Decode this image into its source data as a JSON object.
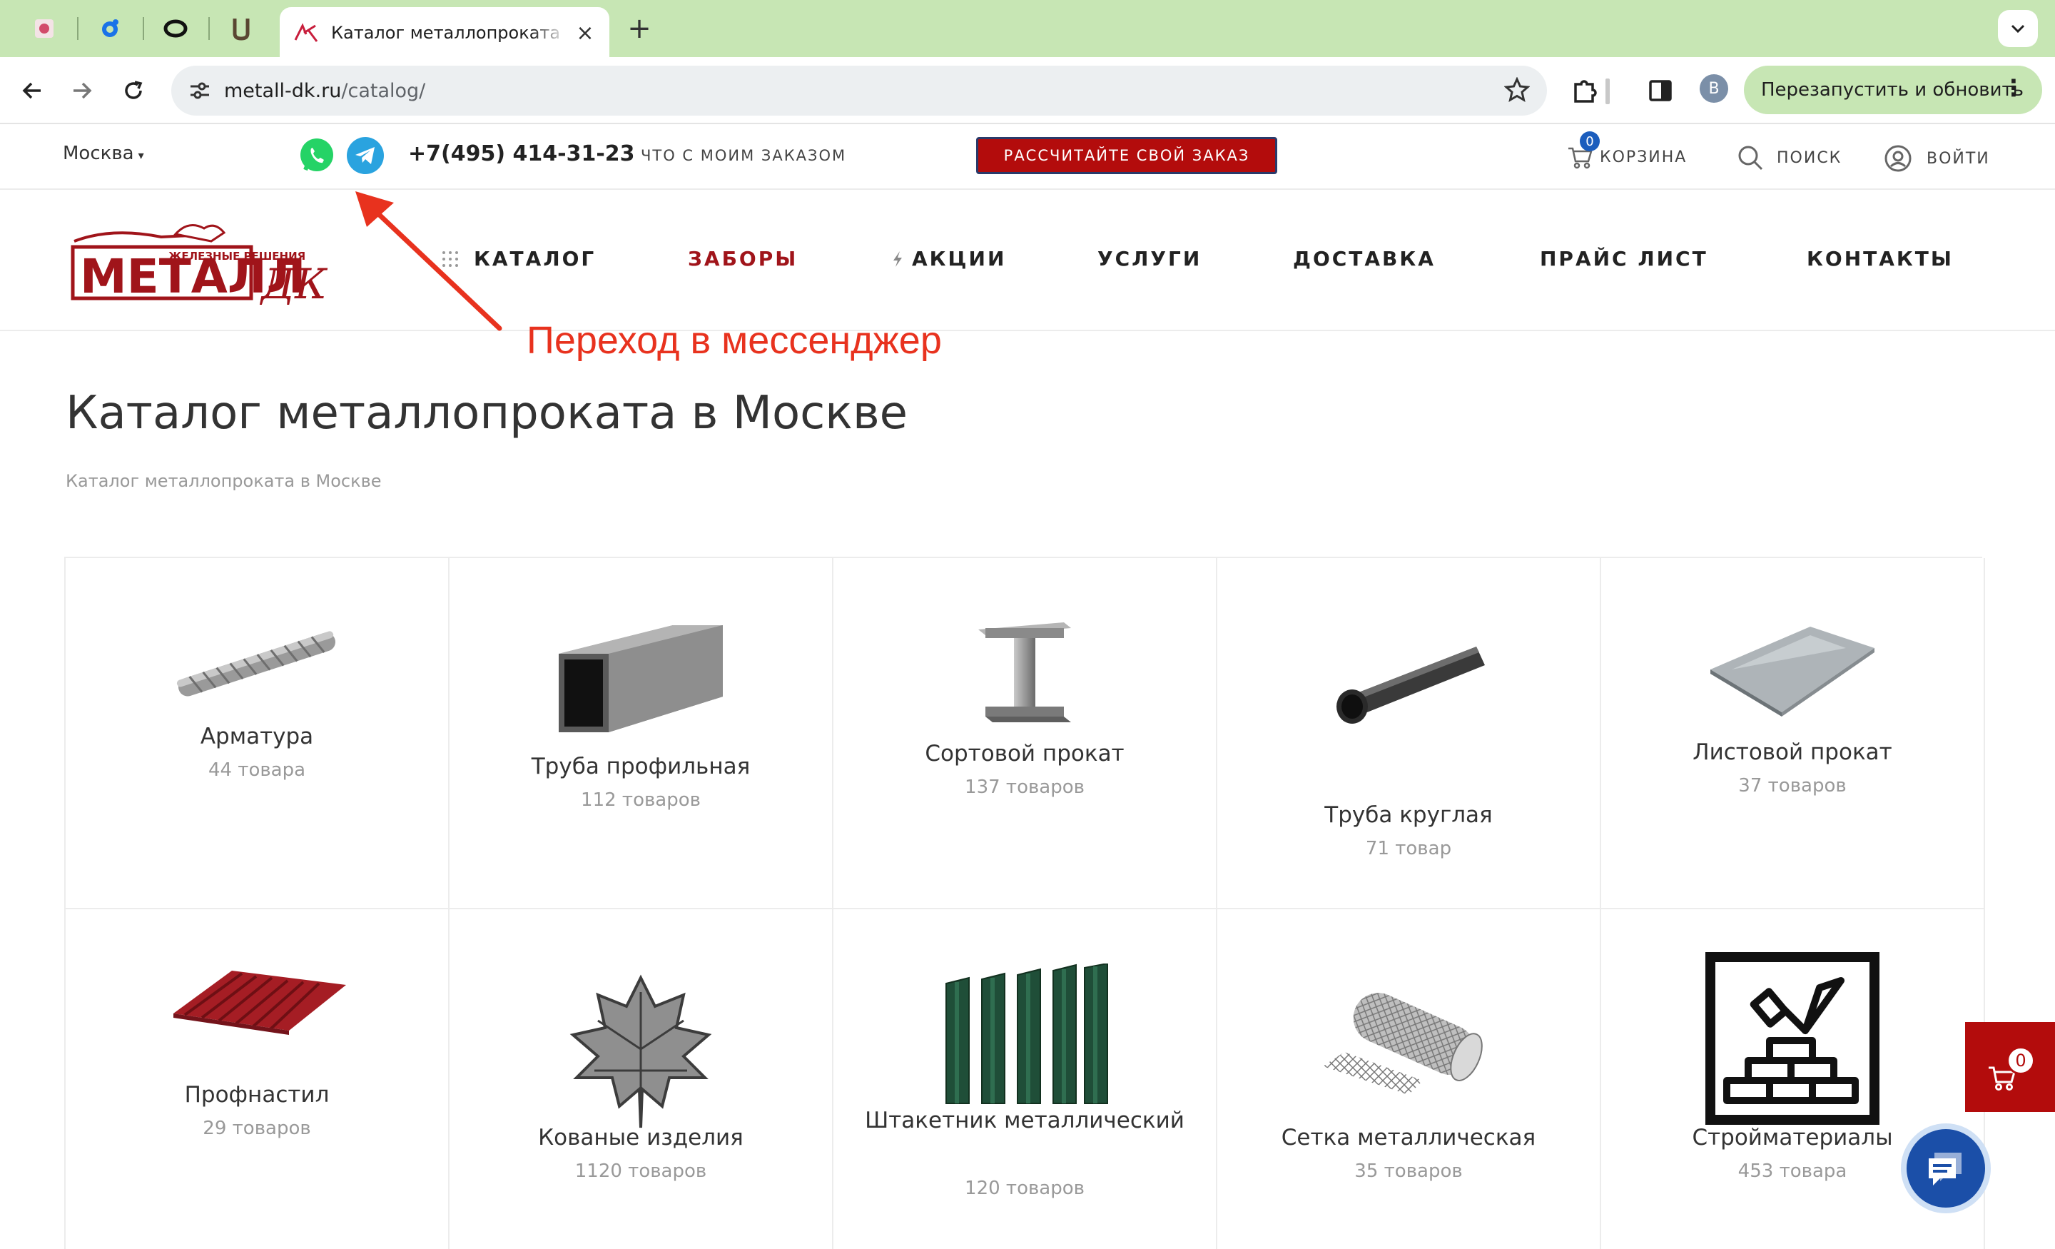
{
  "browser": {
    "pinned_tabs": [
      "favicon-1",
      "favicon-2",
      "favicon-3",
      "favicon-4"
    ],
    "active_tab_title": "Каталог металлопроката в М",
    "url_host": "metall-dk.ru",
    "url_path": "/catalog/",
    "profile_initial": "В",
    "relaunch_label": "Перезапустить и обновить"
  },
  "topbar": {
    "city": "Москва",
    "phone": "+7(495) 414-31-23",
    "order_status_link": "что с моим заказом",
    "calc_button": "Рассчитайте свой заказ",
    "cart_label": "корзина",
    "cart_count": "0",
    "search_label": "поиск",
    "login_label": "войти"
  },
  "nav": {
    "logo_top": "ЖЕЛЕЗНЫЕ РЕШЕНИЯ",
    "logo_main": "МЕТАЛЛ",
    "logo_suffix": "ДК",
    "items": [
      "Каталог",
      "Заборы",
      "Акции",
      "Услуги",
      "Доставка",
      "Прайс лист",
      "Контакты"
    ]
  },
  "annotation": "Переход в мессенджер",
  "page": {
    "title": "Каталог металлопроката в Москве",
    "breadcrumb": "Каталог металлопроката в Москве"
  },
  "catalog": [
    {
      "name": "Арматура",
      "count": "44 товара"
    },
    {
      "name": "Труба профильная",
      "count": "112 товаров"
    },
    {
      "name": "Сортовой прокат",
      "count": "137 товаров"
    },
    {
      "name": "Труба круглая",
      "count": "71 товар"
    },
    {
      "name": "Листовой прокат",
      "count": "37 товаров"
    },
    {
      "name": "Профнастил",
      "count": "29 товаров"
    },
    {
      "name": "Кованые изделия",
      "count": "1120 товаров"
    },
    {
      "name": "Штакетник металлический",
      "count": "120 товаров"
    },
    {
      "name": "Сетка металлическая",
      "count": "35 товаров"
    },
    {
      "name": "Стройматериалы",
      "count": "453 товара"
    }
  ],
  "floating": {
    "cart_count": "0"
  },
  "colors": {
    "brand_red": "#b30c0c",
    "nav_accent": "#a0141a",
    "chrome_green": "#c7e6b4",
    "annotation_red": "#e8321e",
    "whatsapp": "#25d366",
    "telegram": "#2aa3df"
  }
}
